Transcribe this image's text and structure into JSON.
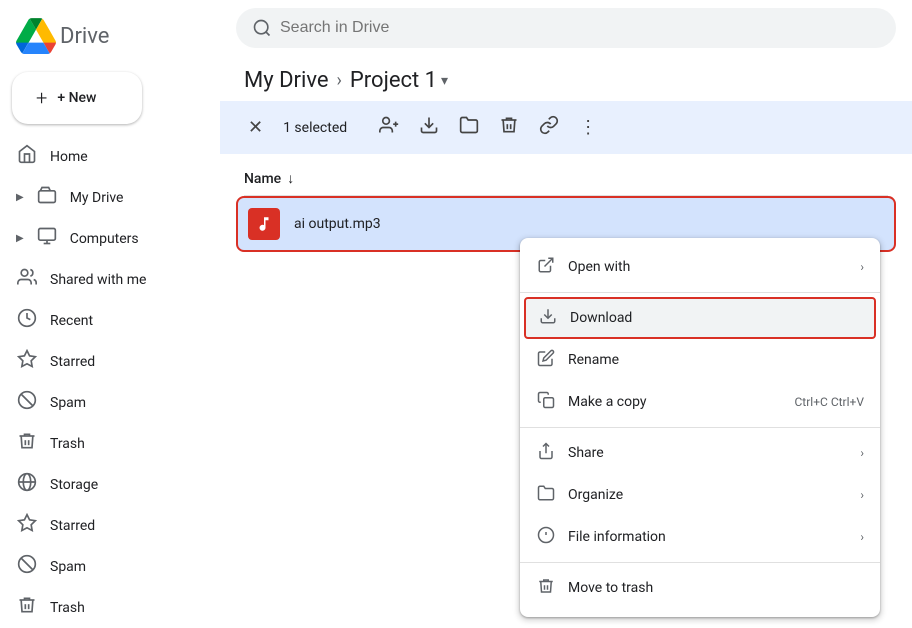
{
  "sidebar": {
    "logo_text": "Drive",
    "new_button": "+ New",
    "nav_items": [
      {
        "id": "home",
        "icon": "⌂",
        "label": "Home",
        "arrow": ""
      },
      {
        "id": "my-drive",
        "icon": "▶",
        "label": "My Drive",
        "arrow": "▶",
        "has_arrow": true
      },
      {
        "id": "computers",
        "icon": "▶",
        "label": "Computers",
        "arrow": "▶",
        "has_arrow": true
      },
      {
        "id": "shared",
        "icon": "👥",
        "label": "Shared with me"
      },
      {
        "id": "recent",
        "icon": "🕐",
        "label": "Recent"
      },
      {
        "id": "starred",
        "icon": "☆",
        "label": "Starred"
      },
      {
        "id": "spam",
        "icon": "⊘",
        "label": "Spam"
      },
      {
        "id": "trash",
        "icon": "🗑",
        "label": "Trash"
      },
      {
        "id": "storage",
        "icon": "☁",
        "label": "Storage"
      },
      {
        "id": "starred2",
        "icon": "☆",
        "label": "Starred"
      },
      {
        "id": "spam2",
        "icon": "⊘",
        "label": "Spam"
      },
      {
        "id": "trash2",
        "icon": "🗑",
        "label": "Trash"
      }
    ]
  },
  "header": {
    "search_placeholder": "Search in Drive"
  },
  "breadcrumb": {
    "root": "My Drive",
    "separator": "›",
    "current": "Project 1",
    "chevron": "▾"
  },
  "toolbar": {
    "selected_label": "1 selected",
    "add_people_icon": "👤+",
    "download_icon": "⬇",
    "move_icon": "📁",
    "delete_icon": "🗑",
    "link_icon": "🔗",
    "more_icon": "⋮"
  },
  "file_list": {
    "name_col": "Name",
    "sort_icon": "↓",
    "files": [
      {
        "id": "ai-output",
        "name": "ai output.mp3",
        "type": "mp3",
        "selected": true
      }
    ]
  },
  "context_menu": {
    "items": [
      {
        "id": "open-with",
        "icon": "⤢",
        "label": "Open with",
        "has_arrow": true,
        "shortcut": ""
      },
      {
        "id": "download",
        "icon": "⬇",
        "label": "Download",
        "highlighted": true,
        "shortcut": ""
      },
      {
        "id": "rename",
        "icon": "✏",
        "label": "Rename",
        "shortcut": ""
      },
      {
        "id": "make-copy",
        "icon": "⧉",
        "label": "Make a copy",
        "shortcut": "Ctrl+C Ctrl+V"
      },
      {
        "id": "share",
        "icon": "👤+",
        "label": "Share",
        "has_arrow": true,
        "shortcut": ""
      },
      {
        "id": "organize",
        "icon": "📁",
        "label": "Organize",
        "has_arrow": true,
        "shortcut": ""
      },
      {
        "id": "file-info",
        "icon": "ℹ",
        "label": "File information",
        "has_arrow": true,
        "shortcut": ""
      },
      {
        "id": "move-trash",
        "icon": "🗑",
        "label": "Move to trash",
        "shortcut": ""
      }
    ],
    "dividers_after": [
      "open-with",
      "make-copy",
      "file-info"
    ]
  },
  "colors": {
    "accent": "#1a73e8",
    "danger": "#d93025",
    "selected_bg": "#d3e3fd",
    "toolbar_bg": "#e8f0fe"
  }
}
